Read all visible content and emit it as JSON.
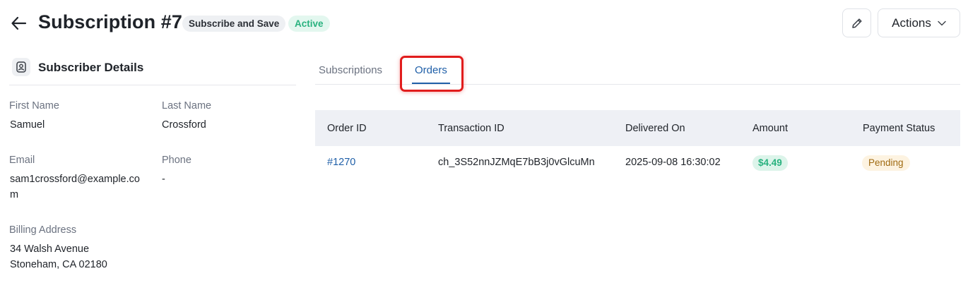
{
  "header": {
    "title": "Subscription #7",
    "type_badge": "Subscribe and Save",
    "status_badge": "Active",
    "actions_label": "Actions",
    "icons": {
      "back": "arrow-left-icon",
      "edit": "pencil-icon",
      "actions": "chevron-down-icon"
    }
  },
  "subscriber": {
    "section_title": "Subscriber Details",
    "icon": "subscriber-card-icon",
    "first_name_label": "First Name",
    "first_name": "Samuel",
    "last_name_label": "Last Name",
    "last_name": "Crossford",
    "email_label": "Email",
    "email_line1": "sam1crossford@example.co",
    "email_line2": "m",
    "phone_label": "Phone",
    "phone": "-",
    "billing_label": "Billing Address",
    "billing_line1": "34 Walsh Avenue",
    "billing_line2": "Stoneham, CA 02180"
  },
  "tabs": [
    {
      "label": "Subscriptions",
      "active": false
    },
    {
      "label": "Orders",
      "active": true
    }
  ],
  "orders": {
    "columns": [
      "Order ID",
      "Transaction ID",
      "Delivered On",
      "Amount",
      "Payment Status"
    ],
    "rows": [
      {
        "order_id": "#1270",
        "transaction_id": "ch_3S52nnJZMqE7bB3j0vGlcuMn",
        "delivered_on": "2025-09-08 16:30:02",
        "amount": "$4.49",
        "payment_status": "Pending"
      }
    ]
  },
  "colors": {
    "accent": "#1f5fa8",
    "active_badge": "#29b27f",
    "pending_badge": "#a06b12",
    "highlight": "#e11c1c"
  }
}
